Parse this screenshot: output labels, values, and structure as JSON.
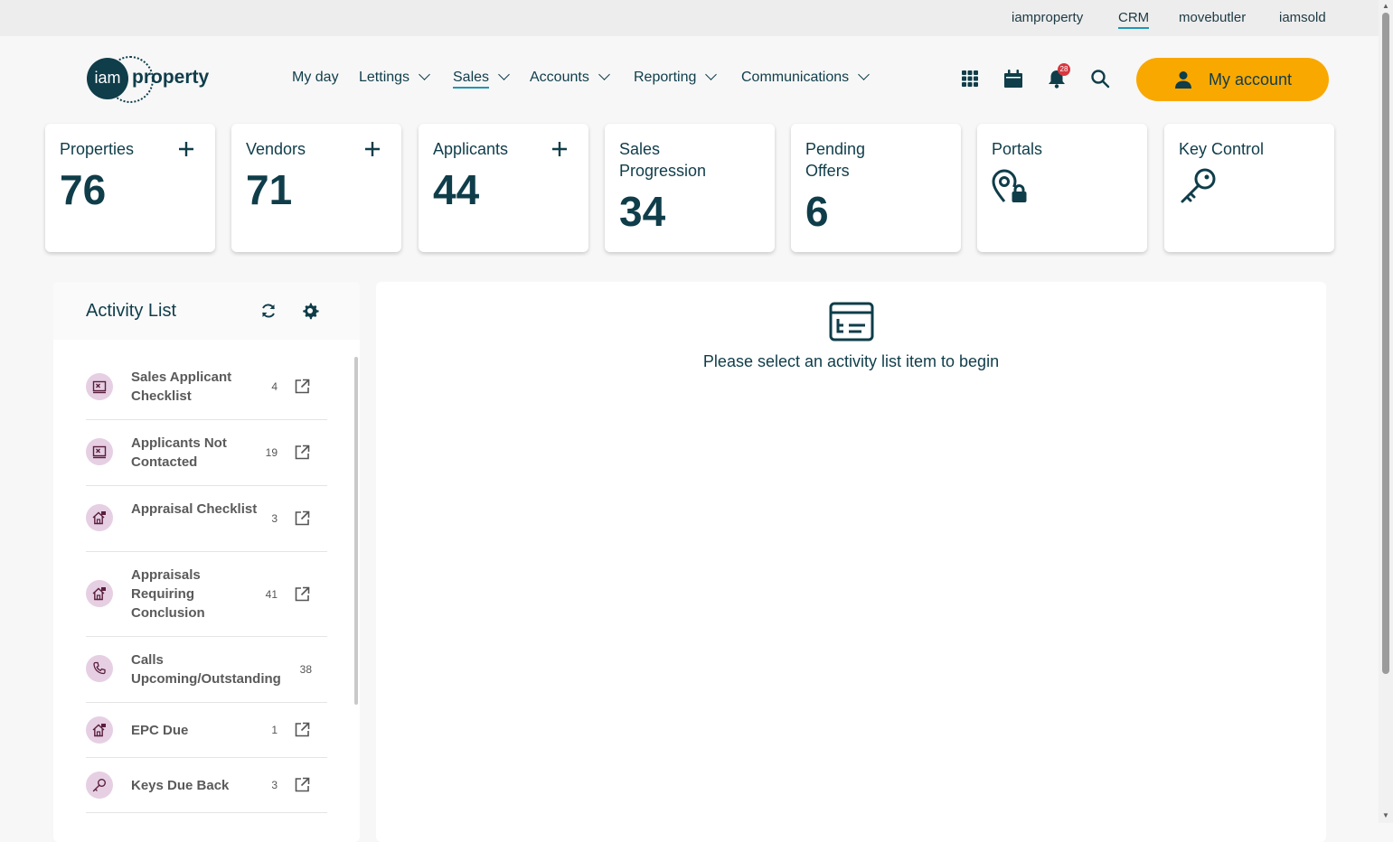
{
  "topbar": {
    "links": [
      "iamproperty",
      "CRM",
      "movebutler",
      "iamsold"
    ],
    "active": "CRM"
  },
  "logo": {
    "mark": "iam",
    "text": "property"
  },
  "nav": {
    "items": [
      {
        "label": "My day"
      },
      {
        "label": "Lettings"
      },
      {
        "label": "Sales"
      },
      {
        "label": "Accounts"
      },
      {
        "label": "Reporting"
      },
      {
        "label": "Communications"
      }
    ],
    "active": "Sales"
  },
  "header_icons": [
    "apps-grid-icon",
    "calendar-icon",
    "bell-icon",
    "search-icon"
  ],
  "notifications": {
    "count": "28"
  },
  "account": {
    "label": "My account"
  },
  "cards": [
    {
      "label": "Properties",
      "value": "76",
      "has_add": true
    },
    {
      "label": "Vendors",
      "value": "71",
      "has_add": true
    },
    {
      "label": "Applicants",
      "value": "44",
      "has_add": true
    },
    {
      "label": "Sales Progression",
      "value": "34",
      "has_add": false
    },
    {
      "label": "Pending Offers",
      "value": "6",
      "has_add": false
    },
    {
      "label": "Portals",
      "icon": "location-lock-icon"
    },
    {
      "label": "Key Control",
      "icon": "key-icon"
    }
  ],
  "activity": {
    "title": "Activity List",
    "items": [
      {
        "label": "Sales Applicant Checklist",
        "count": "4",
        "icon": "checklist-icon"
      },
      {
        "label": "Applicants Not Contacted",
        "count": "19",
        "icon": "checklist-icon"
      },
      {
        "label": "Appraisal Checklist",
        "count": "3",
        "icon": "house-flag-icon"
      },
      {
        "label": "Appraisals Requiring Conclusion",
        "count": "41",
        "icon": "house-flag-icon"
      },
      {
        "label": "Calls Upcoming/Outstanding",
        "count": "38",
        "icon": "phone-icon"
      },
      {
        "label": "EPC Due",
        "count": "1",
        "icon": "house-flag-icon"
      },
      {
        "label": "Keys Due Back",
        "count": "3",
        "icon": "key-icon"
      }
    ]
  },
  "main": {
    "empty_message": "Please select an activity list item to begin"
  },
  "colors": {
    "primary": "#0f3d4a",
    "accent": "#f9a800",
    "link_underline": "#1e97b5",
    "icon_bg": "#e6cfe3",
    "badge": "#d7373f"
  }
}
